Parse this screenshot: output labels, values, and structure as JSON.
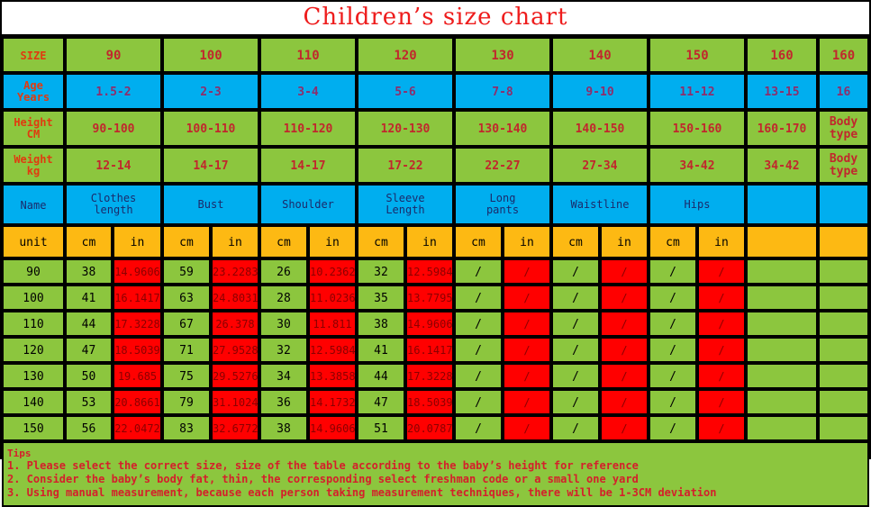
{
  "title": "Children’s size chart",
  "colors": {
    "green": "#8CC63E",
    "blue": "#00AEEF",
    "orange": "#FDB913",
    "red": "#FF0000",
    "title_red": "#EE1C1C",
    "label_red": "#E03B10",
    "border": "#000000"
  },
  "row_labels": {
    "size": "SIZE",
    "age": "Age\nYears",
    "age_l1": "Age",
    "age_l2": "Years",
    "height_l1": "Height",
    "height_l2": "CM",
    "weight_l1": "Weight",
    "weight_l2": "kg",
    "name": "Name",
    "unit": "unit"
  },
  "size_row": [
    "90",
    "100",
    "110",
    "120",
    "130",
    "140",
    "150",
    "160",
    "160"
  ],
  "age_row": [
    "1.5-2",
    "2-3",
    "3-4",
    "5-6",
    "7-8",
    "9-10",
    "11-12",
    "13-15",
    "16"
  ],
  "height_row": [
    "90-100",
    "100-110",
    "110-120",
    "120-130",
    "130-140",
    "140-150",
    "150-160",
    "160-170",
    "Body type"
  ],
  "height_last_l1": "Body",
  "height_last_l2": "type",
  "weight_row": [
    "12-14",
    "14-17",
    "14-17",
    "17-22",
    "22-27",
    "27-34",
    "34-42",
    "34-42",
    "Body type"
  ],
  "weight_last_l1": "Body",
  "weight_last_l2": "type",
  "measure_names": [
    {
      "l1": "Clothes",
      "l2": "length"
    },
    {
      "l1": "Bust",
      "l2": ""
    },
    {
      "l1": "Shoulder",
      "l2": ""
    },
    {
      "l1": "Sleeve",
      "l2": "Length"
    },
    {
      "l1": "Long",
      "l2": "pants"
    },
    {
      "l1": "Waistline",
      "l2": ""
    },
    {
      "l1": "Hips",
      "l2": ""
    },
    {
      "l1": "",
      "l2": ""
    },
    {
      "l1": "",
      "l2": ""
    }
  ],
  "unit_cm": "cm",
  "unit_in": "in",
  "chart_data": {
    "type": "table",
    "title": "Children’s size chart",
    "columns": [
      "unit",
      "Clothes length cm",
      "Clothes length in",
      "Bust cm",
      "Bust in",
      "Shoulder cm",
      "Shoulder in",
      "Sleeve Length cm",
      "Sleeve Length in",
      "Long pants cm",
      "Long pants in",
      "Waistline cm",
      "Waistline in",
      "Hips cm",
      "Hips in"
    ],
    "rows": [
      {
        "size": "90",
        "cells": [
          "38",
          "14.9606",
          "59",
          "23.2283",
          "26",
          "10.2362",
          "32",
          "12.5984",
          "/",
          "/",
          "/",
          "/",
          "/",
          "/"
        ]
      },
      {
        "size": "100",
        "cells": [
          "41",
          "16.1417",
          "63",
          "24.8031",
          "28",
          "11.0236",
          "35",
          "13.7795",
          "/",
          "/",
          "/",
          "/",
          "/",
          "/"
        ]
      },
      {
        "size": "110",
        "cells": [
          "44",
          "17.3228",
          "67",
          "26.378",
          "30",
          "11.811",
          "38",
          "14.9606",
          "/",
          "/",
          "/",
          "/",
          "/",
          "/"
        ]
      },
      {
        "size": "120",
        "cells": [
          "47",
          "18.5039",
          "71",
          "27.9528",
          "32",
          "12.5984",
          "41",
          "16.1417",
          "/",
          "/",
          "/",
          "/",
          "/",
          "/"
        ]
      },
      {
        "size": "130",
        "cells": [
          "50",
          "19.685",
          "75",
          "29.5276",
          "34",
          "13.3858",
          "44",
          "17.3228",
          "/",
          "/",
          "/",
          "/",
          "/",
          "/"
        ]
      },
      {
        "size": "140",
        "cells": [
          "53",
          "20.8661",
          "79",
          "31.1024",
          "36",
          "14.1732",
          "47",
          "18.5039",
          "/",
          "/",
          "/",
          "/",
          "/",
          "/"
        ]
      },
      {
        "size": "150",
        "cells": [
          "56",
          "22.0472",
          "83",
          "32.6772",
          "38",
          "14.9606",
          "51",
          "20.0787",
          "/",
          "/",
          "/",
          "/",
          "/",
          "/"
        ]
      }
    ]
  },
  "tips": {
    "heading": "Tips",
    "line1": "1. Please select the correct size, size of the table according to the baby’s height for reference",
    "line2": "2. Consider the baby’s body fat, thin, the corresponding select freshman code or a small one yard",
    "line3": "3. Using manual measurement, because each person taking measurement techniques, there will be 1-3CM deviation"
  }
}
